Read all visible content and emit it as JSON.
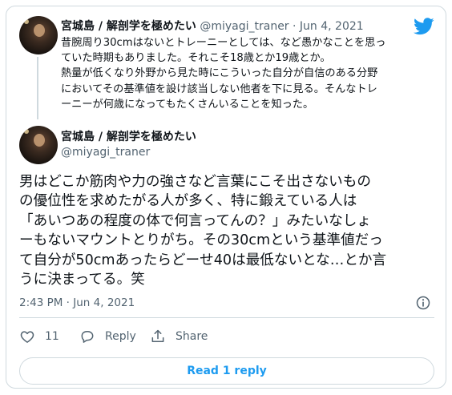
{
  "parent_tweet": {
    "display_name": "宮城島 / 解剖学を極めたい",
    "handle": "@miyagi_traner",
    "separator": "·",
    "date": "Jun 4, 2021",
    "lines": [
      "昔腕周り30cmはないとトレーニーとしては、など愚かなことを思っ",
      "ていた時期もありました。それこそ18歳とか19歳とか。",
      "熱量が低くなり外野から見た時にこういった自分が自信のある分野",
      "においてその基準値を設け該当しない他者を下に見る。そんなトレ",
      "ーニーが何歳になってもたくさんいることを知った。"
    ]
  },
  "main_tweet": {
    "display_name": "宮城島 / 解剖学を極めたい",
    "handle": "@miyagi_traner",
    "lines": [
      "男はどこか筋肉や力の強さなど言葉にこそ出さないもの",
      "の優位性を求めたがる人が多く、特に鍛えている人は",
      "「あいつあの程度の体で何言ってんの？」みたいなしょ",
      "ーもないマウントとりがち。その30cmという基準値だっ",
      "て自分が50cmあったらどーせ40は最低ないとな…とか言",
      "うに決まってる。笑"
    ],
    "timestamp": "2:43 PM · Jun 4, 2021"
  },
  "actions": {
    "like_count": "11",
    "reply_label": "Reply",
    "share_label": "Share"
  },
  "read_reply_label": "Read 1 reply",
  "colors": {
    "twitter_blue": "#1d9bf0",
    "muted_text": "#536471",
    "border": "#cfd9de"
  },
  "icons": [
    "twitter-logo-icon",
    "info-icon",
    "heart-icon",
    "reply-bubble-icon",
    "share-icon"
  ]
}
